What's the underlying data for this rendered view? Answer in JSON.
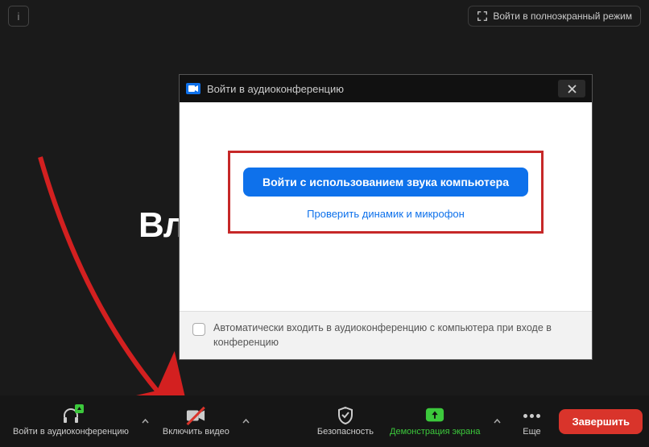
{
  "topbar": {
    "info": "i",
    "fullscreen": "Войти в полноэкранный режим"
  },
  "main_text": "Вл",
  "dialog": {
    "title": "Войти в аудиоконференцию",
    "join_audio_btn": "Войти с использованием звука компьютера",
    "test_link": "Проверить динамик и микрофон",
    "auto_join_label": "Автоматически входить в аудиоконференцию с компьютера при входе в конференцию"
  },
  "controls": {
    "audio": "Войти в аудиоконференцию",
    "video": "Включить видео",
    "security": "Безопасность",
    "share": "Демонстрация экрана",
    "more": "Еще",
    "end": "Завершить"
  }
}
